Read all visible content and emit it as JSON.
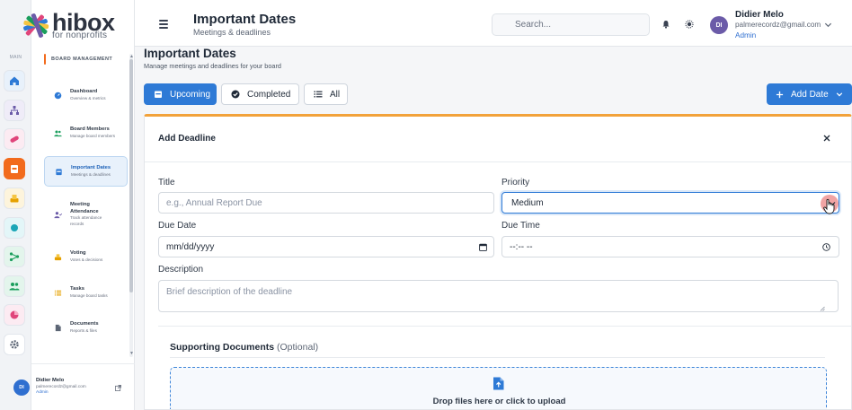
{
  "brand": {
    "name": "hibox",
    "tagline": "for nonprofits"
  },
  "rail": {
    "label": "MAIN",
    "items": [
      {
        "name": "home",
        "color": "#2e7ad6",
        "bg": "#e8f1fb"
      },
      {
        "name": "org",
        "color": "#6b5ba8",
        "bg": "#efecf8"
      },
      {
        "name": "pill",
        "color": "#e0457b",
        "bg": "#fcebf2"
      },
      {
        "name": "calendar",
        "color": "#ffffff",
        "bg": "#f26b1d"
      },
      {
        "name": "vote",
        "color": "#e6a100",
        "bg": "#fdf4dc"
      },
      {
        "name": "circle",
        "color": "#1aa6b7",
        "bg": "#e3f6f8"
      },
      {
        "name": "share",
        "color": "#1a9e5c",
        "bg": "#e3f5ec"
      },
      {
        "name": "users",
        "color": "#1a9e5c",
        "bg": "#e3f5ec"
      },
      {
        "name": "pie",
        "color": "#e0457b",
        "bg": "#fcebf2"
      },
      {
        "name": "gear",
        "color": "#5d6675",
        "bg": "#ffffff"
      }
    ]
  },
  "sidebar": {
    "section": "BOARD MANAGEMENT",
    "items": [
      {
        "title": "Dashboard",
        "sub": "Overview & metrics"
      },
      {
        "title": "Board Members",
        "sub": "Manage board members"
      },
      {
        "title": "Important Dates",
        "sub": "Meetings & deadlines"
      },
      {
        "title": "Meeting Attendance",
        "sub": "Track attendance records"
      },
      {
        "title": "Voting",
        "sub": "Votes & decisions"
      },
      {
        "title": "Tasks",
        "sub": "Manage board tasks"
      },
      {
        "title": "Documents",
        "sub": "Reports & files"
      }
    ],
    "user": {
      "initials": "DI",
      "name": "Didier Melo",
      "email": "palmerecordz@gmail.com",
      "role": "Admin"
    }
  },
  "header": {
    "title": "Important Dates",
    "subtitle": "Meetings & deadlines",
    "search_placeholder": "Search...",
    "user": {
      "initials": "DI",
      "name": "Didier Melo",
      "email": "palmerecordz@gmail.com",
      "role": "Admin"
    }
  },
  "page": {
    "title": "Important Dates",
    "subtitle": "Manage meetings and deadlines for your board",
    "tabs": [
      {
        "label": "Upcoming",
        "active": true
      },
      {
        "label": "Completed",
        "active": false
      },
      {
        "label": "All",
        "active": false
      }
    ],
    "add_button": "Add Date"
  },
  "form": {
    "title": "Add Deadline",
    "title_label": "Title",
    "title_placeholder": "e.g., Annual Report Due",
    "priority_label": "Priority",
    "priority_value": "Medium",
    "due_date_label": "Due Date",
    "due_date_value": "mm/dd/yyyy",
    "due_time_label": "Due Time",
    "due_time_value": "--:-- --",
    "description_label": "Description",
    "description_placeholder": "Brief description of the deadline",
    "supporting_title": "Supporting Documents",
    "supporting_optional": "(Optional)",
    "drop_text": "Drop files here or click to upload"
  },
  "colors": {
    "primary": "#2e7ad6",
    "accent": "#f2a23a",
    "brand_orange": "#f26b1d"
  }
}
